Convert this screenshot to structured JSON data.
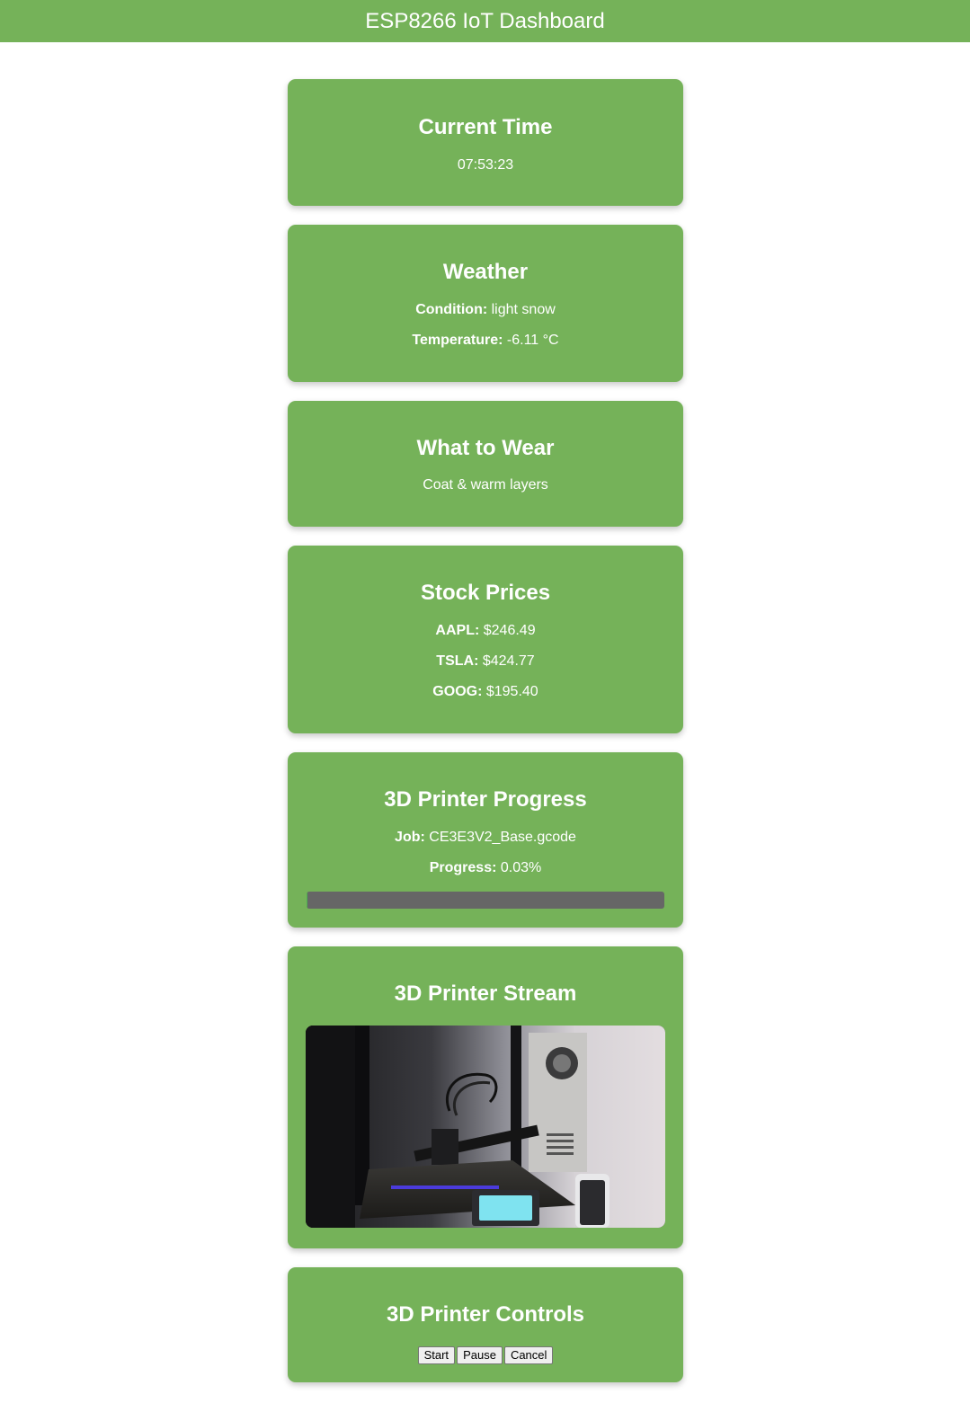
{
  "header": {
    "title": "ESP8266 IoT Dashboard"
  },
  "time": {
    "title": "Current Time",
    "value": "07:53:23"
  },
  "weather": {
    "title": "Weather",
    "condition_label": "Condition:",
    "condition_value": "light snow",
    "temperature_label": "Temperature:",
    "temperature_value": "-6.11 °C"
  },
  "wear": {
    "title": "What to Wear",
    "value": "Coat & warm layers"
  },
  "stocks": {
    "title": "Stock Prices",
    "items": [
      {
        "symbol": "AAPL:",
        "price": "$246.49"
      },
      {
        "symbol": "TSLA:",
        "price": "$424.77"
      },
      {
        "symbol": "GOOG:",
        "price": "$195.40"
      }
    ]
  },
  "printer_progress": {
    "title": "3D Printer Progress",
    "job_label": "Job:",
    "job_value": "CE3E3V2_Base.gcode",
    "progress_label": "Progress:",
    "progress_value": "0.03%",
    "progress_fraction": 0.0003
  },
  "printer_stream": {
    "title": "3D Printer Stream"
  },
  "printer_controls": {
    "title": "3D Printer Controls",
    "start_label": "Start",
    "pause_label": "Pause",
    "cancel_label": "Cancel"
  },
  "colors": {
    "accent": "#75b259",
    "progress_track": "#666666"
  }
}
